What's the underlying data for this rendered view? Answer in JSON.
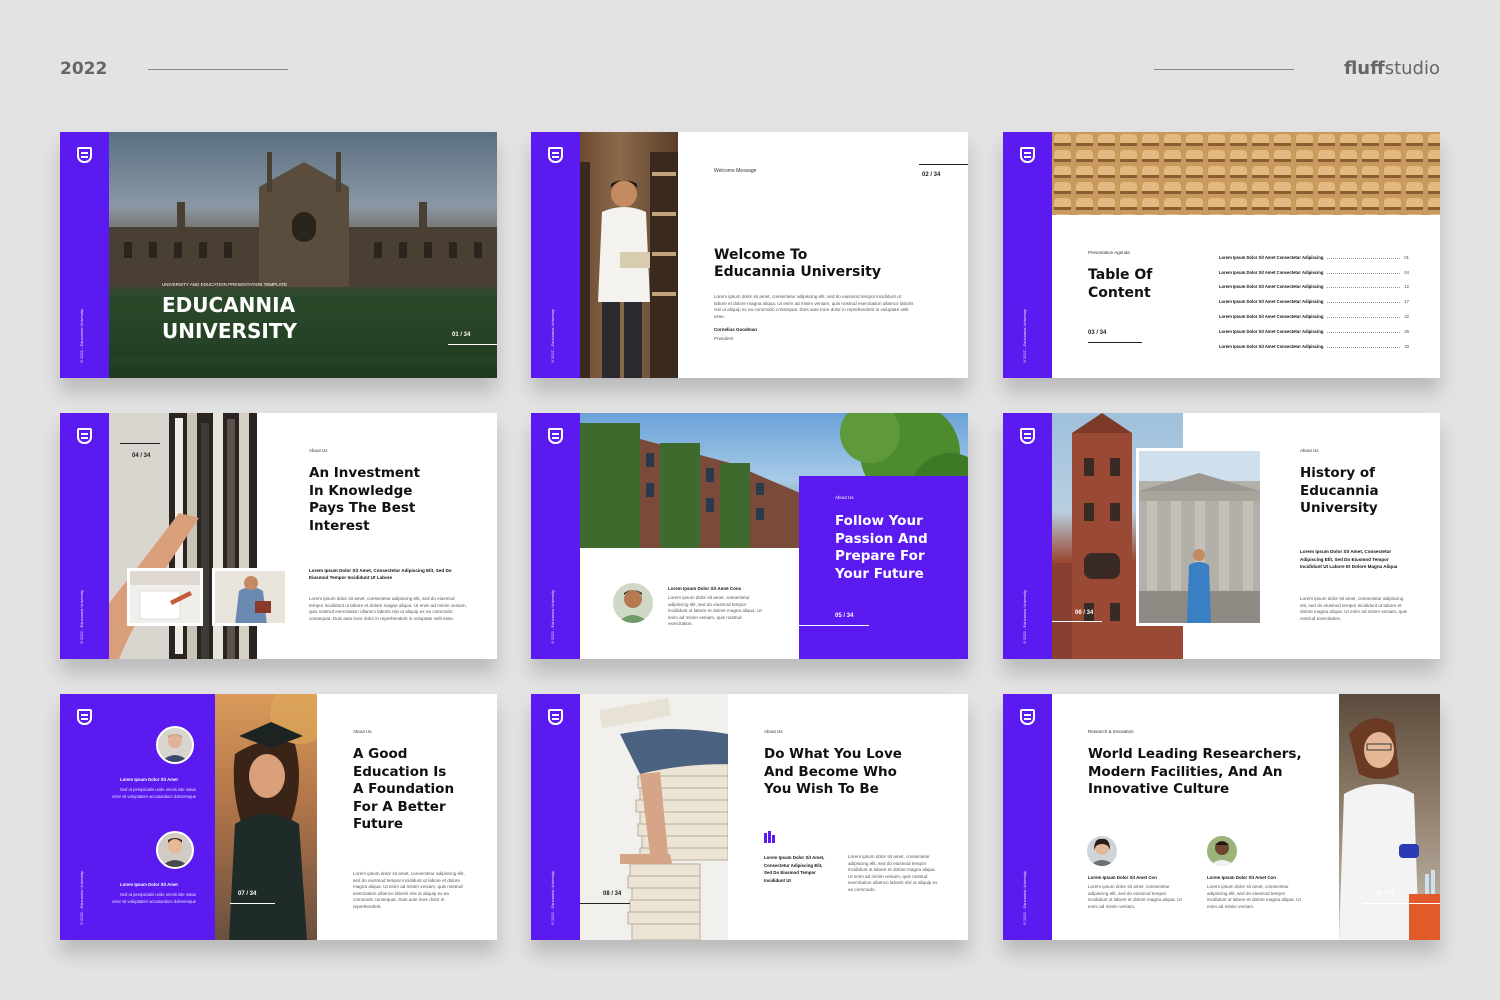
{
  "header": {
    "year": "2022",
    "brand_bold": "fluff",
    "brand_light": "studio"
  },
  "theme": {
    "accent": "#5a1af0"
  },
  "common": {
    "side_text": "©2022 - Educannia University"
  },
  "s1": {
    "eyebrow": "UNIVERSITY AND EDUCATION PRESENTATION TEMPLATE",
    "title1": "EDUCANNIA",
    "title2": "UNIVERSITY",
    "page": "01 / 34"
  },
  "s2": {
    "label": "Welcome Message",
    "page": "02 / 34",
    "title1": "Welcome To",
    "title2": "Educannia University",
    "body": "Lorem ipsum dolor sit amet, consectetur adipiscing elit, sed do eiusmod tempor incididunt ut labore et dolore magna aliqua. Ut enim ad minim veniam, quis nostrud exercitation ullamco laboris nisi ut aliquip ex ea commodo consequat. Duis aute irure dolor in reprehenderit in voluptate velit esse.",
    "name": "Cornelius Goodman",
    "role": "President"
  },
  "s3": {
    "label": "Presentation Agenda",
    "title1": "Table Of",
    "title2": "Content",
    "page": "03 / 34",
    "rows": [
      {
        "text": "Lorem Ipsum Dolor Sit Amet Consectetur Adipiscing",
        "num": "01"
      },
      {
        "text": "Lorem Ipsum Dolor Sit Amet Consectetur Adipiscing",
        "num": "04"
      },
      {
        "text": "Lorem Ipsum Dolor Sit Amet Consectetur Adipiscing",
        "num": "12"
      },
      {
        "text": "Lorem Ipsum Dolor Sit Amet Consectetur Adipiscing",
        "num": "17"
      },
      {
        "text": "Lorem Ipsum Dolor Sit Amet Consectetur Adipiscing",
        "num": "22"
      },
      {
        "text": "Lorem Ipsum Dolor Sit Amet Consectetur Adipiscing",
        "num": "26"
      },
      {
        "text": "Lorem Ipsum Dolor Sit Amet Consectetur Adipiscing",
        "num": "33"
      }
    ]
  },
  "s4": {
    "page": "04 / 34",
    "label": "About Us",
    "title": [
      "An Investment",
      "In Knowledge",
      "Pays The Best",
      "Interest"
    ],
    "lead": "Lorem Ipsum Dolor Sit Amet, Consectetur Adipiscing Elit, Sed Do Eiusmod Tempor Incididunt Ut Labore",
    "body": "Lorem ipsum dolor sit amet, consectetur adipiscing elit, sed do eiusmod tempor incididunt ut labore et dolore magna aliqua. Ut enim ad minim veniam, quis nostrud exercitation ullamco laboris nisi ut aliquip ex ea commodo consequat. Duis aute irure dolor in reprehenderit in voluptate velit esse."
  },
  "s5": {
    "label": "About Us",
    "title": [
      "Follow Your",
      "Passion And",
      "Prepare For",
      "Your Future"
    ],
    "page": "05 / 34",
    "lead": "Lorem Ipsum Dolor Sit Amet Cons",
    "body": "Lorem ipsum dolor sit amet, consectetur adipiscing elit, sed do eiusmod tempor incididunt ut labore et dolore magna aliqua. Ut enim ad minim veniam, quis nostrud exercitation."
  },
  "s6": {
    "page": "06 / 34",
    "label": "About Us",
    "title": [
      "History of",
      "Educannia",
      "University"
    ],
    "lead": "Lorem Ipsum Dolor Sit Amet, Consectetur Adipiscing Elit, Sed Do Eiusmod Tempor Incididunt Ut Labore Et Dolore Magna Aliqua",
    "body": "Lorem ipsum dolor sit amet, consectetur adipiscing elit, sed do eiusmod tempor incididunt ut labore et dolore magna aliqua. Ut enim ad minim veniam, quis nostrud exercitation."
  },
  "s7": {
    "person1": "Lorem Ipsum Dolor Sit Amet",
    "desc1": "Sed ut perspiciatis unde omnis iste natus error sit voluptatem accusantium doloremque",
    "person2": "Lorem Ipsum Dolor Sit Amet",
    "desc2": "Sed ut perspiciatis unde omnis iste natus error sit voluptatem accusantium doloremque",
    "page": "07 / 34",
    "label": "About Us",
    "title": [
      "A Good",
      "Education Is",
      "A Foundation",
      "For A Better",
      "Future"
    ],
    "body": "Lorem ipsum dolor sit amet, consectetur adipiscing elit, sed do eiusmod tempor incididunt ut labore et dolore magna aliqua. Ut enim ad minim veniam, quis nostrud exercitation ullamco laboris nisi ut aliquip ex ea commodo consequat. Duis aute irure dolor in reprehenderit."
  },
  "s8": {
    "page": "08 / 34",
    "label": "About Us",
    "title": [
      "Do What You Love",
      "And Become Who",
      "You Wish To Be"
    ],
    "lead": "Lorem Ipsum Dolor Sit Amet, Consectetur Adipiscing Elit, Sed Do Eiusmod Tempor Incididunt Ut",
    "body": "Lorem ipsum dolor sit amet, consectetur adipiscing elit, sed do eiusmod tempor incididunt ut labore et dolore magna aliqua. Ut enim ad minim veniam, quis nostrud exercitation ullamco laboris nisi ut aliquip ex ea commodo."
  },
  "s9": {
    "label": "Research & Innovation",
    "title": [
      "World Leading Researchers,",
      "Modern Facilities, And An",
      "Innovative Culture"
    ],
    "p1": "Lorem Ipsum Dolor Sit Amet Con",
    "d1": "Lorem ipsum dolor sit amet, consectetur adipiscing elit, sed do eiusmod tempor incididunt ut labore et dolore magna aliqua. Ut enim ad minim veniam.",
    "p2": "Lorem Ipsum Dolor Sit Amet Con",
    "d2": "Lorem ipsum dolor sit amet, consectetur adipiscing elit, sed do eiusmod tempor incididunt ut labore et dolore magna aliqua. Ut enim ad minim veniam.",
    "page": "09 / 34"
  }
}
